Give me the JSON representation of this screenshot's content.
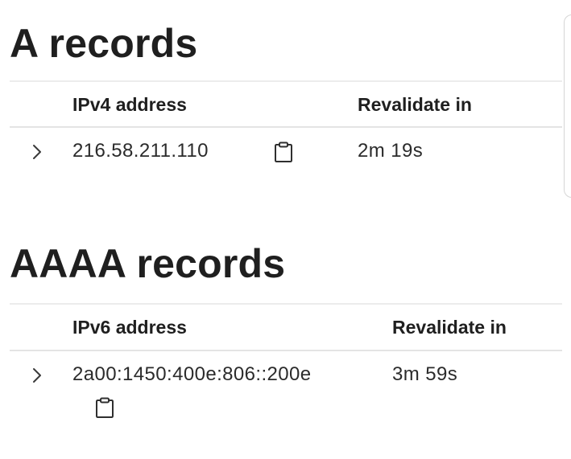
{
  "a_records": {
    "title": "A records",
    "headers": {
      "address": "IPv4 address",
      "revalidate": "Revalidate in"
    },
    "rows": [
      {
        "address": "216.58.211.110",
        "revalidate": "2m 19s"
      }
    ]
  },
  "aaaa_records": {
    "title": "AAAA records",
    "headers": {
      "address": "IPv6 address",
      "revalidate": "Revalidate in"
    },
    "rows": [
      {
        "address": "2a00:1450:400e:806::200e",
        "revalidate": "3m 59s"
      }
    ]
  },
  "icons": {
    "expand": "chevron-right-icon",
    "copy": "clipboard-icon"
  }
}
